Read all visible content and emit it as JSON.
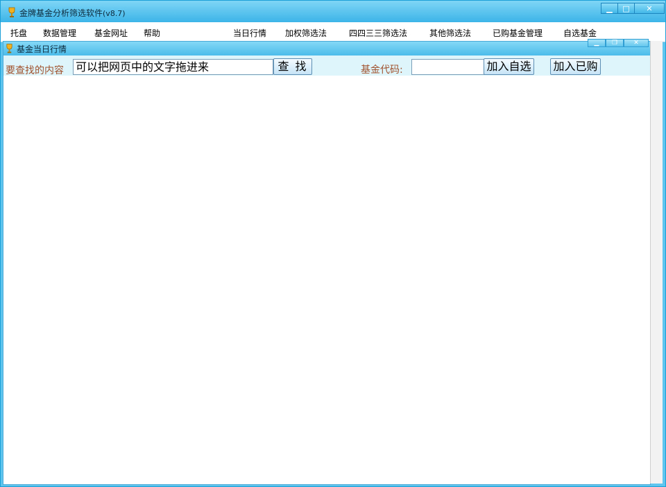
{
  "window": {
    "title": "金牌基金分析筛选软件",
    "version": "(v8.7)",
    "controls": {
      "minimize": "▁",
      "maximize": "□",
      "close": "✕"
    }
  },
  "menu": {
    "items": [
      "托盘",
      "数据管理",
      "基金网址",
      "帮助",
      "当日行情",
      "加权筛选法",
      "四四三三筛选法",
      "其他筛选法",
      "已购基金管理",
      "自选基金"
    ]
  },
  "child_window": {
    "title": "基金当日行情",
    "controls": {
      "minimize": "▁",
      "restore": "❐",
      "close": "✕"
    }
  },
  "search": {
    "label": "要查找的内容",
    "value": "可以把网页中的文字拖进来",
    "button": "查 找"
  },
  "fund_code": {
    "label": "基金代码:",
    "value": "",
    "add_favorite": "加入自选",
    "add_bought": "加入已购"
  },
  "icons": {
    "app": "trophy-icon",
    "child": "trophy-icon"
  },
  "colors": {
    "titlebar": "#3cb4e8",
    "toolbar": "#dff5fc",
    "label": "#a0522d"
  }
}
